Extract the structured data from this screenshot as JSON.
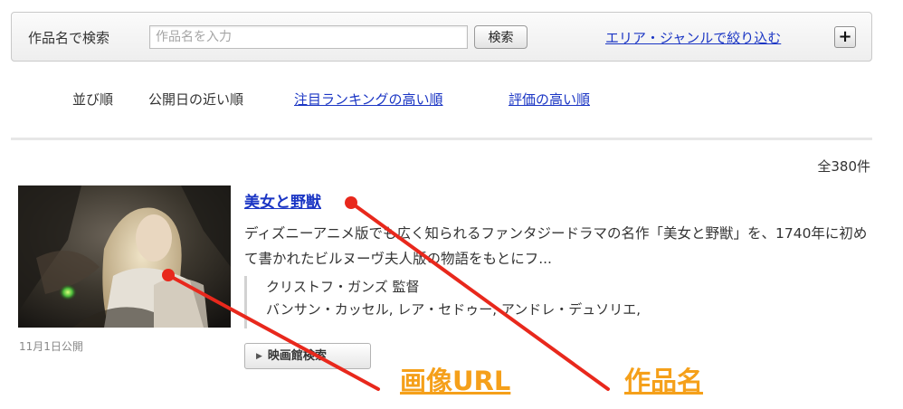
{
  "search": {
    "label": "作品名で検索",
    "placeholder": "作品名を入力",
    "value": "",
    "button_label": "検索",
    "filter_link": "エリア・ジャンルで絞り込む",
    "expand_icon": "plus-icon",
    "expand_symbol": "+"
  },
  "sort": {
    "title": "並び順",
    "current": "公開日の近い順",
    "options": [
      "注目ランキングの高い順",
      "評価の高い順"
    ]
  },
  "results": {
    "total": "全380件"
  },
  "movie": {
    "title": "美女と野獣",
    "release": "11月1日公開",
    "synopsis": "ディズニーアニメ版でも広く知られるファンタジードラマの名作「美女と野獣」を、1740年に初めて書かれたビルヌーヴ夫人版の物語をもとにフ...",
    "director": "クリストフ・ガンズ 監督",
    "cast": "バンサン・カッセル, レア・セドゥー, アンドレ・デュソリエ,",
    "theater_button": "映画館検索",
    "theater_icon": "triangle-right-icon"
  },
  "annotations": {
    "image_label": "画像URL",
    "title_label": "作品名",
    "color": "#f5a01a",
    "arrow_color": "#e8281c"
  }
}
